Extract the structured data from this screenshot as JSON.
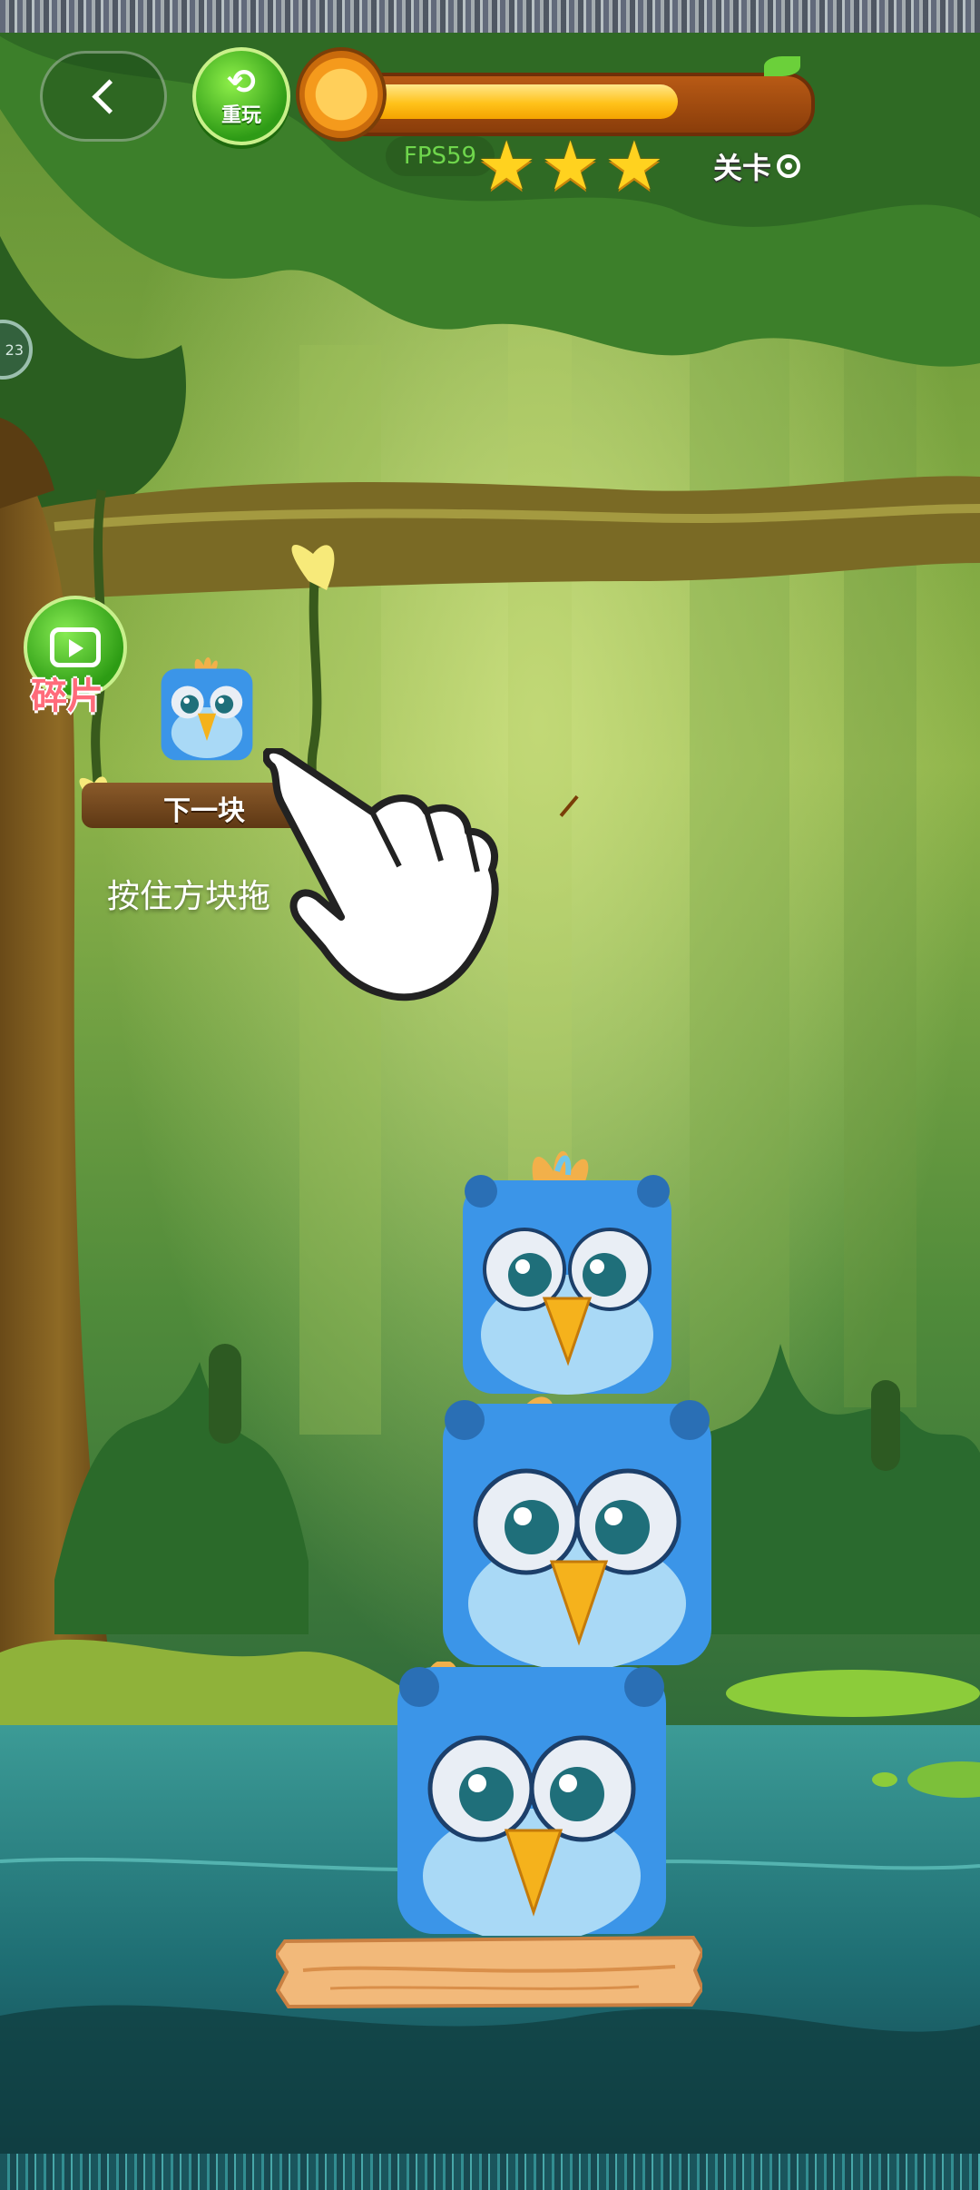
{
  "header": {
    "replay_label": "重玩",
    "fps_text": "FPS59",
    "level_text": "关卡",
    "timer_progress": 0.73,
    "stars_count": 3
  },
  "side": {
    "bubble_text": "23"
  },
  "fragment": {
    "label": "碎片"
  },
  "next_block": {
    "label": "下一块"
  },
  "hint": {
    "text": "按住方块拖"
  },
  "colors": {
    "bird_blue": "#3b95e8",
    "bird_belly": "#a9d9f6",
    "beak": "#f5b21c",
    "star": "#ffd21f",
    "replay_green": "#2e9b16",
    "timer_fill": "#ffc21a"
  }
}
